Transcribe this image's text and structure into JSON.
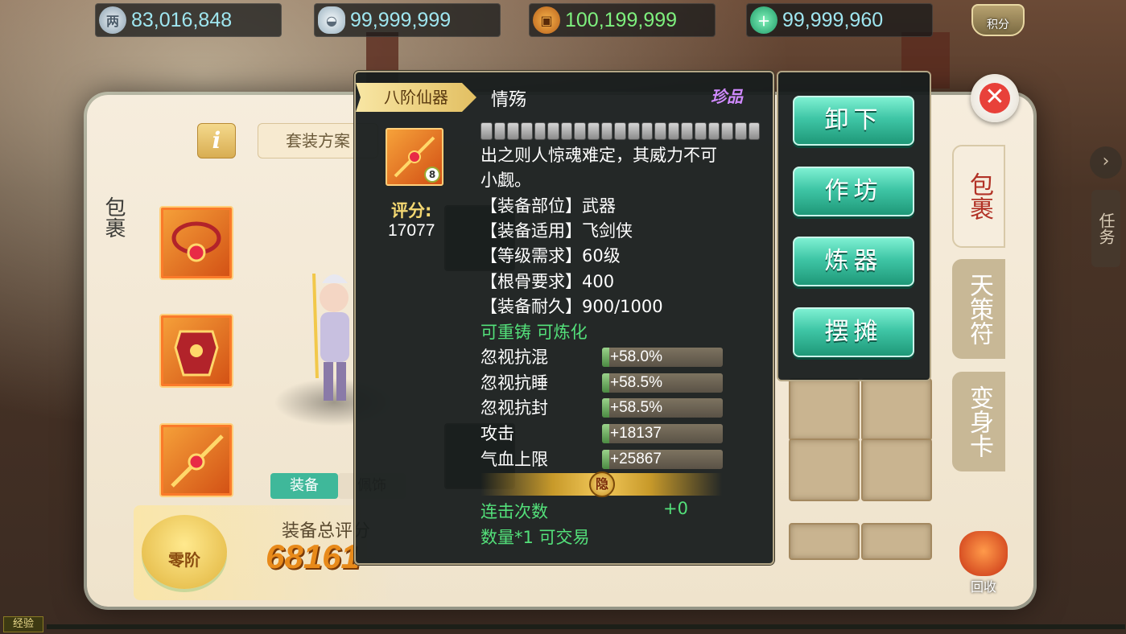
{
  "currencies": [
    {
      "icon": "silver-coin-icon",
      "value": "83,016,848",
      "color": "#9fe6f0"
    },
    {
      "icon": "silver-ingot-icon",
      "value": "99,999,999",
      "color": "#9fe6f0"
    },
    {
      "icon": "copper-coin-icon",
      "value": "100,199,999",
      "color": "#7ef07e"
    },
    {
      "icon": "jade-plus-icon",
      "value": "99,999,960",
      "color": "#9fe6f0"
    }
  ],
  "points_label": "积分",
  "inventory": {
    "left_title": "包裹",
    "info_icon": "i",
    "suit_tab": "套装方案",
    "equip_tab": "装备",
    "accessory_tab": "佩饰",
    "total_score_label": "装备总评分",
    "total_score": "68161",
    "stage_label": "零阶"
  },
  "side_tabs": [
    "包裹",
    "天策符",
    "变身卡"
  ],
  "recycle_label": "回收",
  "task_label": "任务",
  "exp_label": "经验",
  "tooltip": {
    "tier_label": "八阶仙器",
    "item_name": "情殇",
    "rarity": "珍品",
    "item_level": "8",
    "score_label": "评分:",
    "score": "17077",
    "gem_slots": 21,
    "description_1": "出之则人惊魂难定，其威力不可",
    "description_2": "小觑。",
    "lines": [
      "【装备部位】武器",
      "【装备适用】飞剑侠",
      "【等级需求】60级",
      "【根骨要求】400",
      "【装备耐久】900/1000"
    ],
    "tags": "可重铸 可炼化",
    "attributes": [
      {
        "name": "忽视抗混",
        "value": "+58.0%",
        "fill": 0.06
      },
      {
        "name": "忽视抗睡",
        "value": "+58.5%",
        "fill": 0.06
      },
      {
        "name": "忽视抗封",
        "value": "+58.5%",
        "fill": 0.06
      },
      {
        "name": "攻击",
        "value": "+18137",
        "fill": 0.06
      },
      {
        "name": "气血上限",
        "value": "+25867",
        "fill": 0.06
      }
    ],
    "hide_label": "隐",
    "combo_label": "连击次数",
    "combo_value": "+0",
    "footer": "数量*1 可交易"
  },
  "actions": [
    "卸下",
    "作坊",
    "炼器",
    "摆摊"
  ],
  "colors": {
    "accent_green": "#3fc6a6",
    "attr_green": "#53e07a",
    "rarity_purple": "#d08aff"
  }
}
